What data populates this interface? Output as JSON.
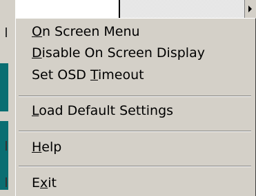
{
  "menu": {
    "items": [
      {
        "pre": "",
        "key": "O",
        "post": "n Screen Menu"
      },
      {
        "pre": "",
        "key": "D",
        "post": "isable On Screen Display"
      },
      {
        "pre": "Set OSD ",
        "key": "T",
        "post": "imeout"
      },
      {
        "pre": "",
        "key": "L",
        "post": "oad Default Settings"
      },
      {
        "pre": "",
        "key": "H",
        "post": "elp"
      },
      {
        "pre": "E",
        "key": "x",
        "post": "it"
      }
    ]
  },
  "colors": {
    "menu_face": "#d4d0c8",
    "teal": "#0a6e72"
  }
}
